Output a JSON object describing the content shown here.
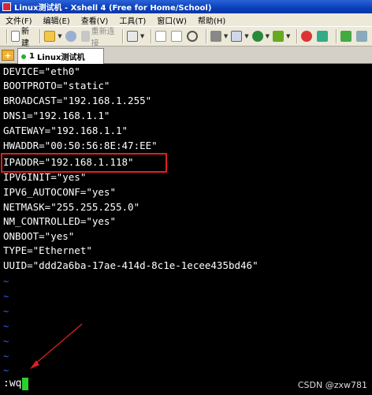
{
  "window": {
    "title": "Linux测试机 - Xshell 4 (Free for Home/School)"
  },
  "menu": [
    "文件(F)",
    "编辑(E)",
    "查看(V)",
    "工具(T)",
    "窗口(W)",
    "帮助(H)"
  ],
  "toolbar": {
    "new_label": "新建",
    "reconnect_label": "重新连接"
  },
  "tab": {
    "number": "1",
    "label": "Linux测试机"
  },
  "terminal": {
    "lines": [
      "DEVICE=\"eth0\"",
      "BOOTPROTO=\"static\"",
      "BROADCAST=\"192.168.1.255\"",
      "DNS1=\"192.168.1.1\"",
      "GATEWAY=\"192.168.1.1\"",
      "HWADDR=\"00:50:56:8E:47:EE\"",
      "IPADDR=\"192.168.1.118\"",
      "IPV6INIT=\"yes\"",
      "IPV6_AUTOCONF=\"yes\"",
      "NETMASK=\"255.255.255.0\"",
      "NM_CONTROLLED=\"yes\"",
      "ONBOOT=\"yes\"",
      "TYPE=\"Ethernet\"",
      "UUID=\"ddd2a6ba-17ae-414d-8c1e-1ecee435bd46\""
    ],
    "tilde": "~",
    "command": ":wq"
  },
  "watermark": "CSDN @zxw781",
  "colors": {
    "highlight": "#e02020",
    "cursor": "#28d228",
    "tilde": "#3a5cff",
    "arrow": "#e02020"
  }
}
